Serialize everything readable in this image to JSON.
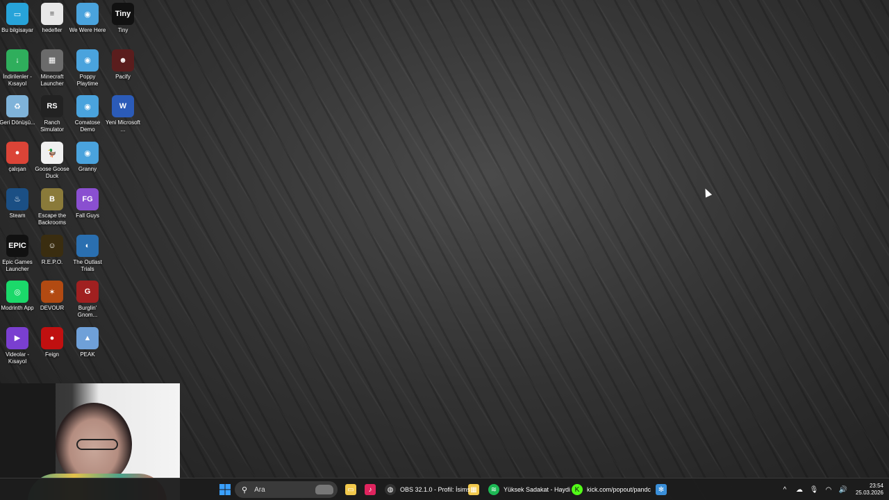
{
  "desktop": {
    "icons": [
      {
        "label": "Bu bilgisayar",
        "icon": "computer-icon",
        "color": "#27a3d9",
        "glyph": "▭"
      },
      {
        "label": "hedefler",
        "icon": "text-file-icon",
        "color": "#e8e8e8",
        "glyph": "≡"
      },
      {
        "label": "We Were Here",
        "icon": "globe-icon",
        "color": "#4aa3dd",
        "glyph": "◉"
      },
      {
        "label": "Tiny",
        "icon": "tiny-game-icon",
        "color": "#111111",
        "glyph": "Tiny"
      },
      {
        "label": "İndirilenler - Kısayol",
        "icon": "downloads-folder-icon",
        "color": "#2fae5c",
        "glyph": "↓"
      },
      {
        "label": "Minecraft Launcher",
        "icon": "minecraft-icon",
        "color": "#6b6b6b",
        "glyph": "▦"
      },
      {
        "label": "Poppy Playtime",
        "icon": "globe-icon",
        "color": "#4aa3dd",
        "glyph": "◉"
      },
      {
        "label": "Pacify",
        "icon": "pacify-game-icon",
        "color": "#5a1d1d",
        "glyph": "☻"
      },
      {
        "label": "Geri Dönüşü...",
        "icon": "recycle-bin-icon",
        "color": "#7fb3d9",
        "glyph": "♻"
      },
      {
        "label": "Ranch Simulator",
        "icon": "ranch-simulator-icon",
        "color": "#222222",
        "glyph": "RS"
      },
      {
        "label": "Comatose Demo",
        "icon": "globe-icon",
        "color": "#4aa3dd",
        "glyph": "◉"
      },
      {
        "label": "Yeni Microsoft ...",
        "icon": "word-document-icon",
        "color": "#2b5bb8",
        "glyph": "W"
      },
      {
        "label": "çalışan",
        "icon": "chrome-icon",
        "color": "#db4437",
        "glyph": "●"
      },
      {
        "label": "Goose Goose Duck",
        "icon": "goose-game-icon",
        "color": "#f0f0f0",
        "glyph": "🦆"
      },
      {
        "label": "Granny",
        "icon": "globe-icon",
        "color": "#4aa3dd",
        "glyph": "◉"
      },
      {
        "label": "",
        "icon": "",
        "color": "",
        "glyph": ""
      },
      {
        "label": "Steam",
        "icon": "steam-icon",
        "color": "#1b4f84",
        "glyph": "♨"
      },
      {
        "label": "Escape the Backrooms",
        "icon": "backrooms-game-icon",
        "color": "#8a7a3a",
        "glyph": "B"
      },
      {
        "label": "Fall Guys",
        "icon": "fall-guys-icon",
        "color": "#8a4fd0",
        "glyph": "FG"
      },
      {
        "label": "",
        "icon": "",
        "color": "",
        "glyph": ""
      },
      {
        "label": "Epic Games Launcher",
        "icon": "epic-games-icon",
        "color": "#111111",
        "glyph": "EPIC"
      },
      {
        "label": "R.E.P.O.",
        "icon": "repo-game-icon",
        "color": "#3a2d10",
        "glyph": "☺"
      },
      {
        "label": "The Outlast Trials",
        "icon": "outlast-game-icon",
        "color": "#2a6fb0",
        "glyph": "◐"
      },
      {
        "label": "",
        "icon": "",
        "color": "",
        "glyph": ""
      },
      {
        "label": "Modrinth App",
        "icon": "modrinth-icon",
        "color": "#1bd96a",
        "glyph": "◎"
      },
      {
        "label": "DEVOUR",
        "icon": "devour-game-icon",
        "color": "#b24a12",
        "glyph": "✶"
      },
      {
        "label": "Burglin' Gnom...",
        "icon": "burglin-gnomes-icon",
        "color": "#a02020",
        "glyph": "G"
      },
      {
        "label": "",
        "icon": "",
        "color": "",
        "glyph": ""
      },
      {
        "label": "Videolar - Kısayol",
        "icon": "videos-folder-icon",
        "color": "#7a3fd0",
        "glyph": "▶"
      },
      {
        "label": "Feign",
        "icon": "feign-game-icon",
        "color": "#c01010",
        "glyph": "●"
      },
      {
        "label": "PEAK",
        "icon": "peak-game-icon",
        "color": "#6fa0d8",
        "glyph": "▲"
      }
    ]
  },
  "taskbar": {
    "search_placeholder": "Ara",
    "apps": [
      {
        "name": "obs-taskbar-button",
        "icon": "obs-icon",
        "label": "OBS 32.1.0 - Profil: İsims",
        "color": "#333333",
        "glyph": "◍"
      },
      {
        "name": "spotify-taskbar-button",
        "icon": "spotify-icon",
        "label": "Yüksek Sadakat - Haydi",
        "color": "#1db954",
        "glyph": "≋"
      },
      {
        "name": "kick-taskbar-button",
        "icon": "kick-icon",
        "label": "kick.com/popout/pandc",
        "color": "#53fc18",
        "glyph": "K"
      }
    ],
    "pinned": [
      {
        "name": "file-explorer-button",
        "icon": "file-explorer-icon",
        "color": "#f2c94c",
        "glyph": "▭"
      },
      {
        "name": "tiktok-button",
        "icon": "tiktok-icon",
        "color": "#e0245e",
        "glyph": "♪"
      },
      {
        "name": "store-button",
        "icon": "store-icon",
        "color": "#f2c94c",
        "glyph": "▦"
      },
      {
        "name": "settings-app-button",
        "icon": "gear-app-icon",
        "color": "#3a8fd9",
        "glyph": "✻"
      }
    ],
    "clock": {
      "time": "23:54",
      "date": "25.03.2026"
    },
    "tray": [
      {
        "name": "show-hidden-icons-button",
        "icon": "chevron-up-icon",
        "glyph": "^"
      },
      {
        "name": "onedrive-tray-button",
        "icon": "cloud-icon",
        "glyph": "☁"
      },
      {
        "name": "microphone-tray-button",
        "icon": "microphone-icon",
        "glyph": "🎙"
      },
      {
        "name": "wifi-tray-button",
        "icon": "wifi-icon",
        "glyph": "◠"
      },
      {
        "name": "volume-tray-button",
        "icon": "speaker-icon",
        "glyph": "🔊"
      }
    ]
  }
}
